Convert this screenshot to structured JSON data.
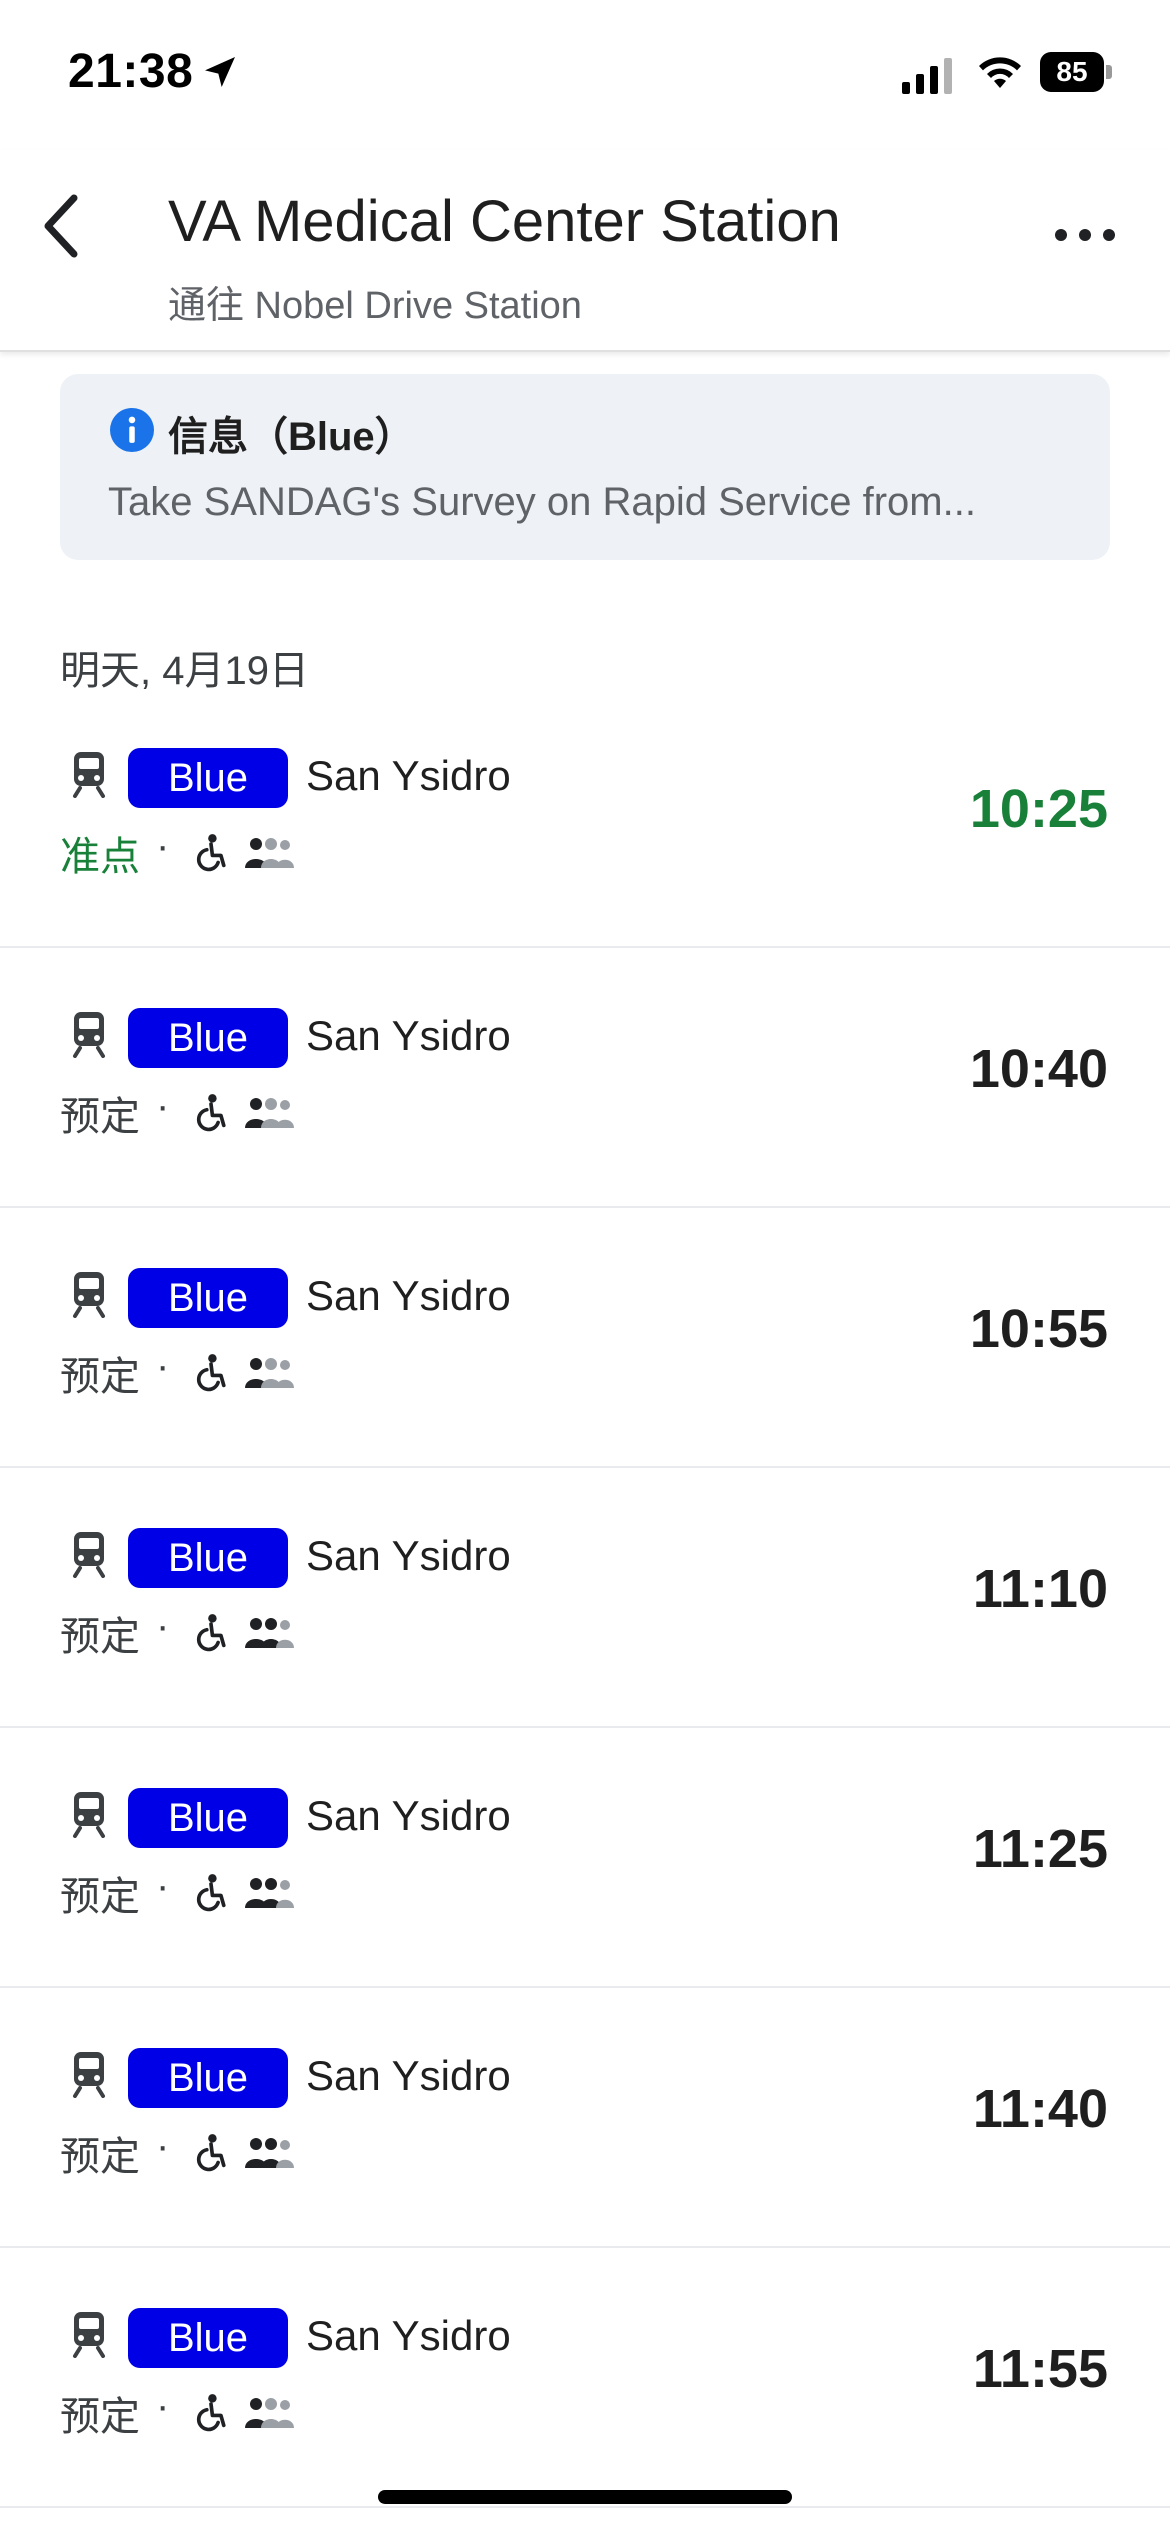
{
  "status_bar": {
    "time": "21:38",
    "battery": "85"
  },
  "header": {
    "title": "VA Medical Center Station",
    "subtitle": "通往 Nobel Drive Station"
  },
  "alert": {
    "title": "信息（Blue）",
    "text": "Take SANDAG's Survey on Rapid Service from..."
  },
  "date_label": "明天, 4月19日",
  "colors": {
    "route_badge": "#0000e6",
    "on_time": "#188038"
  },
  "departures": [
    {
      "route": "Blue",
      "destination": "San Ysidro",
      "status": "准点",
      "time": "10:25",
      "on_time": true,
      "crowd_level": 1
    },
    {
      "route": "Blue",
      "destination": "San Ysidro",
      "status": "预定",
      "time": "10:40",
      "on_time": false,
      "crowd_level": 1
    },
    {
      "route": "Blue",
      "destination": "San Ysidro",
      "status": "预定",
      "time": "10:55",
      "on_time": false,
      "crowd_level": 1
    },
    {
      "route": "Blue",
      "destination": "San Ysidro",
      "status": "预定",
      "time": "11:10",
      "on_time": false,
      "crowd_level": 2
    },
    {
      "route": "Blue",
      "destination": "San Ysidro",
      "status": "预定",
      "time": "11:25",
      "on_time": false,
      "crowd_level": 2
    },
    {
      "route": "Blue",
      "destination": "San Ysidro",
      "status": "预定",
      "time": "11:40",
      "on_time": false,
      "crowd_level": 2
    },
    {
      "route": "Blue",
      "destination": "San Ysidro",
      "status": "预定",
      "time": "11:55",
      "on_time": false,
      "crowd_level": 1
    }
  ],
  "icons": {
    "back": "chevron-left-icon",
    "more": "more-horizontal-icon",
    "info": "info-icon",
    "tram": "tram-icon",
    "accessible": "wheelchair-icon",
    "crowd": "crowd-level-icon"
  }
}
